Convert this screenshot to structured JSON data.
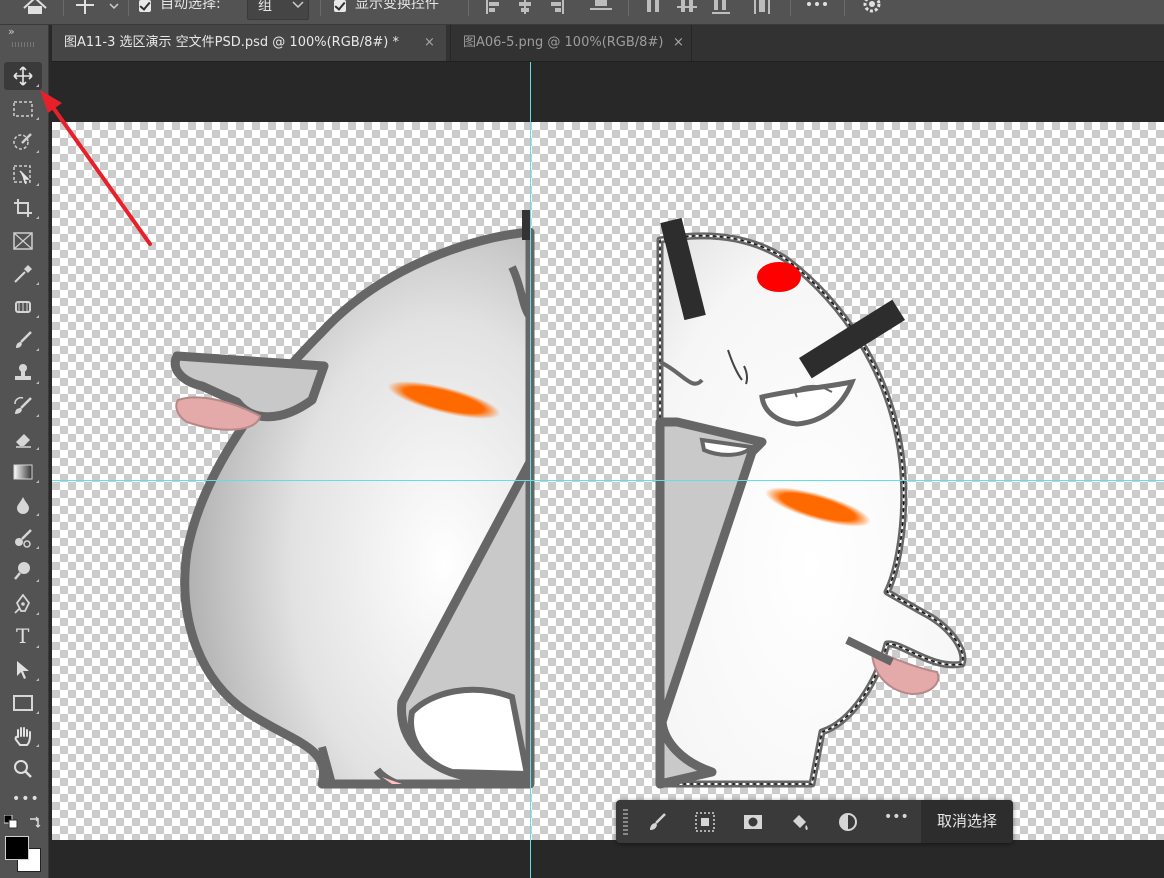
{
  "options_bar": {
    "home_icon": "home-icon",
    "auto_select_label": "自动选择:",
    "auto_select_checked": true,
    "auto_select_target": "组",
    "show_transform_label": "显示变换控件",
    "show_transform_checked": true
  },
  "tabs": [
    {
      "label": "图A11-3 选区演示 空文件PSD.psd @ 100%(RGB/8#) *",
      "active": true,
      "close": "×"
    },
    {
      "label": "图A06-5.png @ 100%(RGB/8#)",
      "active": false,
      "close": "×"
    }
  ],
  "tools": [
    "move-tool",
    "rectangular-marquee-tool",
    "object-selection-tool",
    "frame-select-tool",
    "crop-tool",
    "frame-tool",
    "eyedropper-tool",
    "healing-brush-tool",
    "brush-tool",
    "clone-stamp-tool",
    "history-brush-tool",
    "eraser-tool",
    "gradient-tool",
    "blur-tool",
    "mixer-tool",
    "dodge-tool",
    "pen-tool",
    "type-tool",
    "path-selection-tool",
    "rectangle-tool",
    "hand-tool",
    "zoom-tool",
    "more-tools"
  ],
  "tools_text": {
    "type_tool_glyph": "T",
    "more_glyph": "•••"
  },
  "colors": {
    "foreground": "#000000",
    "background": "#ffffff",
    "guide": "#5ee0e8",
    "annotation_arrow": "#e8202a"
  },
  "taskbar": {
    "buttons": [
      "brush-selection-icon",
      "transform-selection-icon",
      "mask-icon",
      "fill-icon",
      "adjustment-icon",
      "more-icon"
    ],
    "more_glyph": "•••",
    "deselect_label": "取消选择"
  }
}
